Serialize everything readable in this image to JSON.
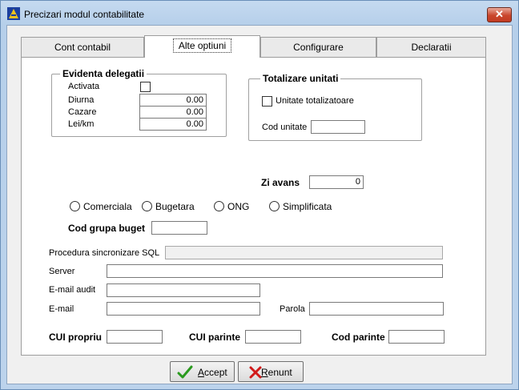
{
  "window": {
    "title": "Precizari modul contabilitate",
    "close_glyph": "✕",
    "icon": "app-icon"
  },
  "tabs": [
    {
      "label": "Cont contabil",
      "active": false
    },
    {
      "label": "Alte optiuni",
      "active": true
    },
    {
      "label": "Configurare",
      "active": false
    },
    {
      "label": "Declaratii",
      "active": false
    }
  ],
  "delegatii": {
    "legend": "Evidenta delegatii",
    "activata_label": "Activata",
    "diurna_label": "Diurna",
    "diurna_value": "0.00",
    "cazare_label": "Cazare",
    "cazare_value": "0.00",
    "leikm_label": "Lei/km",
    "leikm_value": "0.00"
  },
  "totalizare": {
    "legend": "Totalizare unitati",
    "checkbox_label": "Unitate totalizatoare",
    "cod_label": "Cod unitate",
    "cod_value": ""
  },
  "zi_avans": {
    "label": "Zi avans",
    "value": "0"
  },
  "radios": [
    {
      "label": "Comerciala",
      "selected": false
    },
    {
      "label": "Bugetara",
      "selected": false
    },
    {
      "label": "ONG",
      "selected": false
    },
    {
      "label": "Simplificata",
      "selected": false
    }
  ],
  "cod_grupa": {
    "label": "Cod grupa buget",
    "value": ""
  },
  "sql": {
    "label": "Procedura sincronizare SQL",
    "value": ""
  },
  "server": {
    "label": "Server",
    "value": ""
  },
  "email_audit": {
    "label": "E-mail audit",
    "value": ""
  },
  "email": {
    "label": "E-mail",
    "value": ""
  },
  "parola": {
    "label": "Parola",
    "value": ""
  },
  "cui_propriu": {
    "label": "CUI propriu",
    "value": ""
  },
  "cui_parinte": {
    "label": "CUI parinte",
    "value": ""
  },
  "cod_parinte": {
    "label": "Cod parinte",
    "value": ""
  },
  "buttons": {
    "accept": {
      "mnemonic": "A",
      "rest": "ccept",
      "icon": "checkmark-icon",
      "color": "#2a9a1e"
    },
    "renunt": {
      "mnemonic": "R",
      "rest": "enunt",
      "icon": "cross-icon",
      "color": "#d11a1a"
    }
  }
}
